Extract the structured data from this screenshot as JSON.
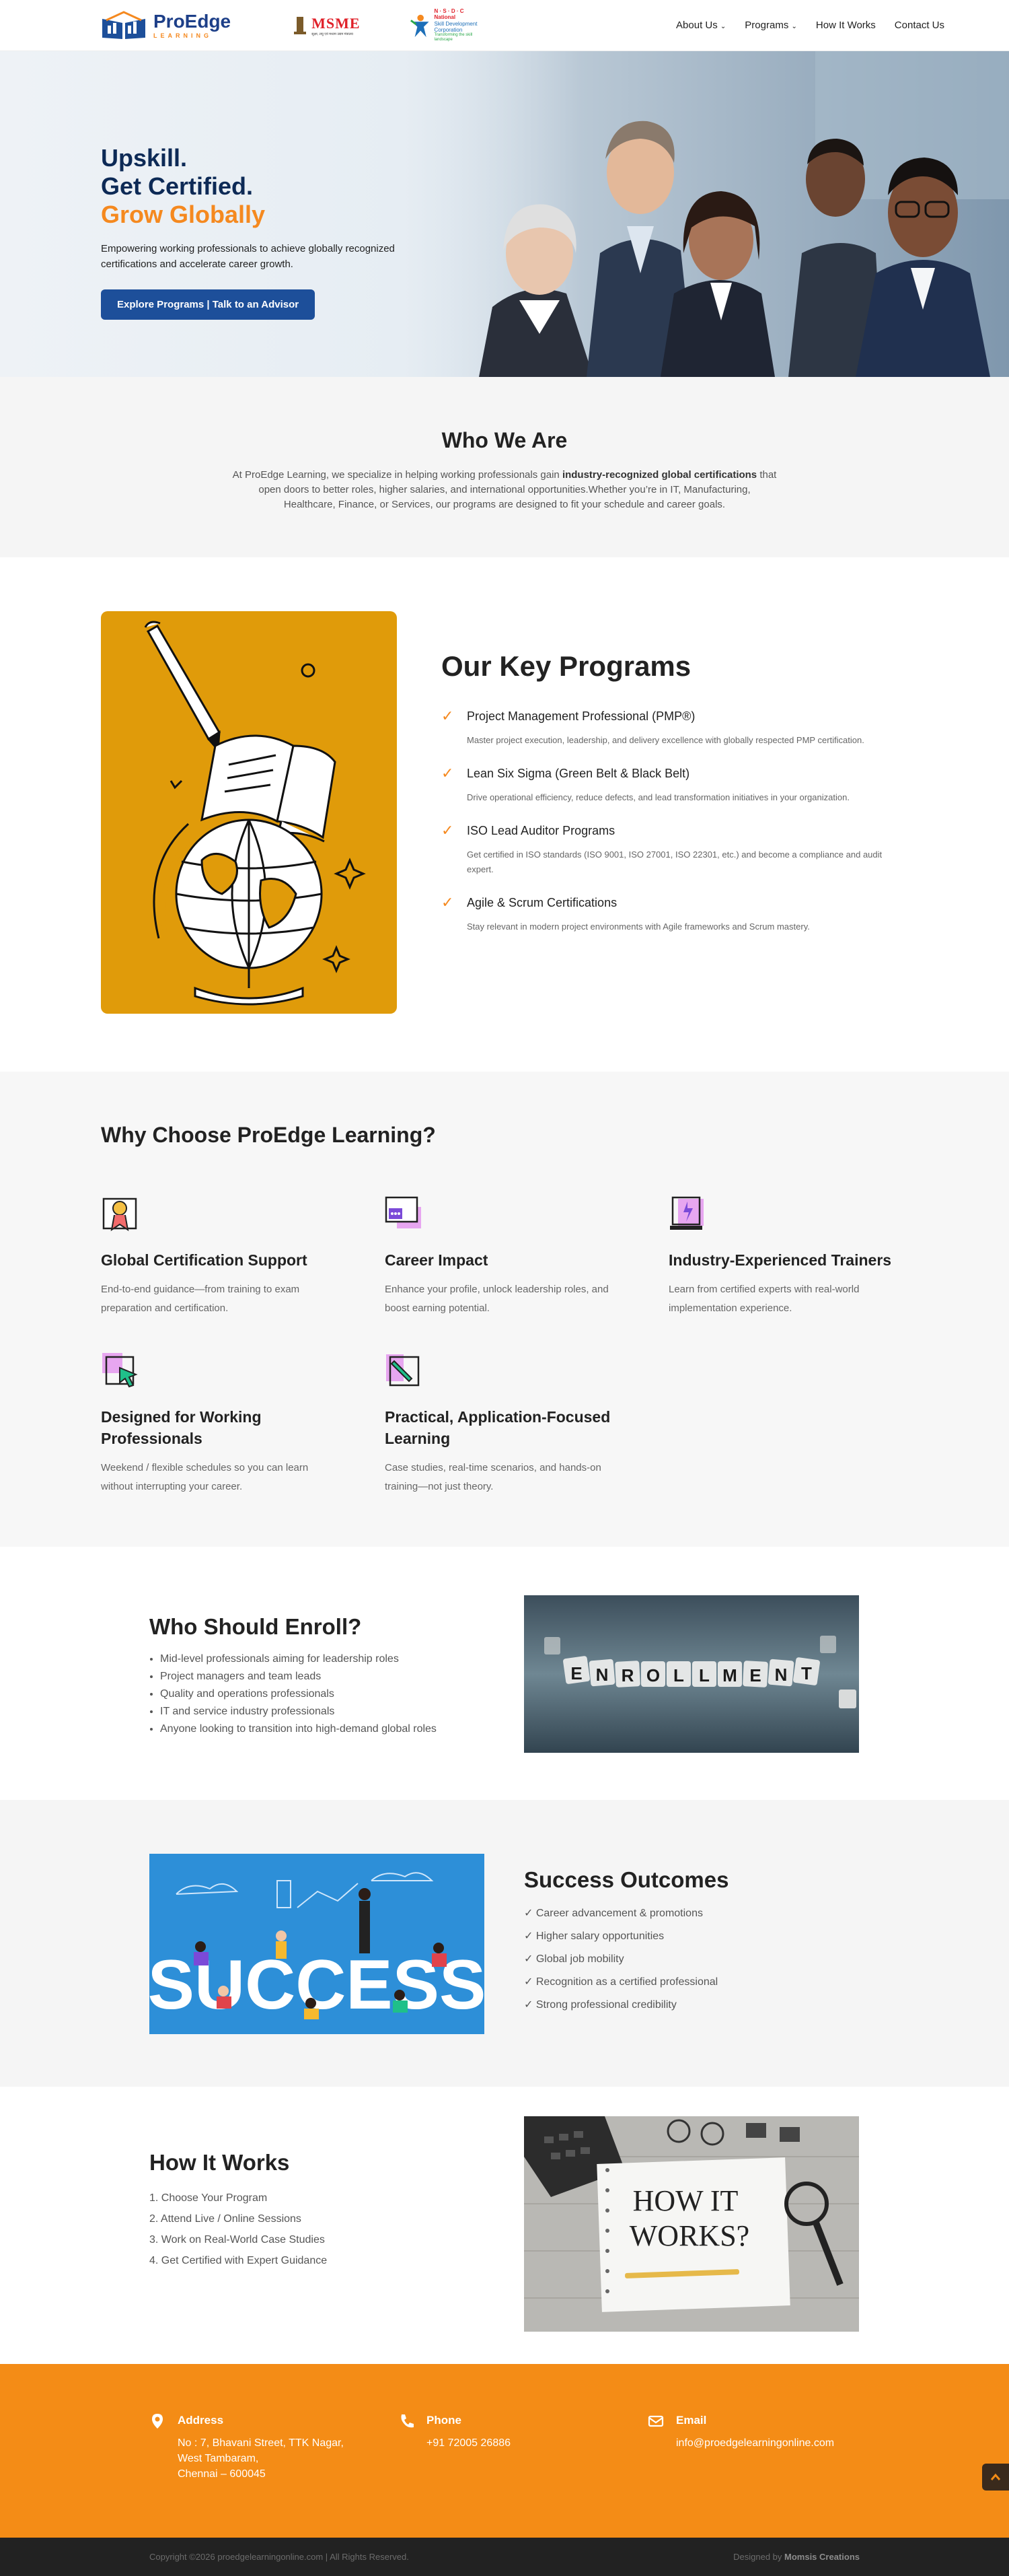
{
  "header": {
    "brand": "ProEdge",
    "brand_sub": "LEARNING",
    "msme_logo_text": "MSME",
    "msme_logo_caption": "सूक्ष्म, लघु एवं मध्यम उद्यम मंत्रालय",
    "nsdc_logo_text": [
      "N · S · D · C",
      "National",
      "Skill Development",
      "Corporation",
      "Transforming the skill landscape"
    ],
    "nav": [
      "About Us",
      "Programs",
      "How It Works",
      "Contact Us"
    ]
  },
  "hero": {
    "line1": "Upskill.",
    "line2": "Get Certified.",
    "line3": "Grow Globally",
    "desc": "Empowering working professionals to achieve globally recognized certifications and accelerate career growth.",
    "cta": "Explore Programs | Talk to an Advisor"
  },
  "who": {
    "title": "Who We Are",
    "p1": "At ProEdge Learning, we specialize in helping working professionals gain ",
    "bold": "industry-recognized global certifications",
    "p2": " that open doors to better roles, higher salaries, and international opportunities.Whether you’re in IT, Manufacturing, Healthcare, Finance, or Services, our programs are designed to fit your schedule and career goals."
  },
  "programs": {
    "title": "Our Key Programs",
    "items": [
      {
        "title": "Project Management Professional (PMP®)",
        "desc": "Master project execution, leadership, and delivery excellence with globally respected PMP certification."
      },
      {
        "title": "Lean Six Sigma (Green Belt & Black Belt)",
        "desc": "Drive operational efficiency, reduce defects, and lead transformation initiatives in your organization."
      },
      {
        "title": "ISO Lead Auditor Programs",
        "desc": "Get certified in ISO standards (ISO 9001, ISO 27001, ISO 22301, etc.) and become a compliance and audit expert."
      },
      {
        "title": "Agile & Scrum Certifications",
        "desc": "Stay relevant in modern project environments with Agile frameworks and Scrum mastery."
      }
    ]
  },
  "why": {
    "title": "Why Choose ProEdge Learning?",
    "features": [
      {
        "icon": "certificate-icon",
        "title": "Global Certification Support",
        "desc": "End-to-end guidance—from training to exam preparation and certification."
      },
      {
        "icon": "presentation-icon",
        "title": "Career Impact",
        "desc": "Enhance your profile, unlock leadership roles, and boost earning potential."
      },
      {
        "icon": "laptop-icon",
        "title": "Industry-Experienced Trainers",
        "desc": "Learn from certified experts with real-world implementation experience."
      },
      {
        "icon": "cursor-icon",
        "title": "Designed for Working Professionals",
        "desc": "Weekend / flexible schedules so you can learn without interrupting your career."
      },
      {
        "icon": "pencil-icon",
        "title": "Practical, Application-Focused Learning",
        "desc": "Case studies, real-time scenarios, and hands-on training—not just theory."
      }
    ]
  },
  "enroll": {
    "title": "Who Should Enroll?",
    "items": [
      "Mid-level professionals aiming for leadership roles",
      "Project managers and team leads",
      "Quality and operations professionals",
      "IT and service industry professionals",
      "Anyone looking to transition into high-demand global roles"
    ],
    "image_text": "ENROLLMENT"
  },
  "success": {
    "title": "Success Outcomes",
    "items": [
      "✓ Career advancement & promotions",
      "✓ Higher salary opportunities",
      "✓ Global job mobility",
      "✓ Recognition as a certified professional",
      "✓ Strong professional credibility"
    ],
    "image_text": "SUCCESS"
  },
  "how": {
    "title": "How It Works",
    "items": [
      "1. Choose Your Program",
      "2. Attend Live / Online Sessions",
      "3. Work on Real-World Case Studies",
      "4. Get Certified with Expert Guidance"
    ],
    "image_text_1": "HOW IT",
    "image_text_2": "WORKS?"
  },
  "footer": {
    "address_label": "Address",
    "address_lines": [
      "No : 7, Bhavani Street, TTK Nagar,",
      "West Tambaram,",
      "Chennai – 600045"
    ],
    "phone_label": "Phone",
    "phone": "+91 72005 26886",
    "email_label": "Email",
    "email": "info@proedgelearningonline.com",
    "copyright": "Copyright ©2026 proedgelearningonline.com | All Rights Reserved.",
    "designed_by_prefix": "Designed by ",
    "designed_by": "Momsis Creations"
  },
  "colors": {
    "navy": "#0d2a56",
    "orange": "#f5891f",
    "mustard": "#e09b0a",
    "footer": "#f48c16"
  }
}
